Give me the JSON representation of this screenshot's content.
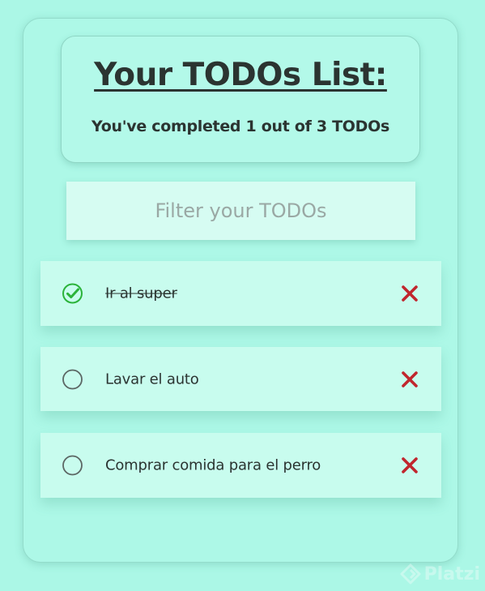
{
  "header": {
    "title": "Your TODOs List:",
    "progress": "You've completed 1 out of 3 TODOs"
  },
  "search": {
    "placeholder": "Filter your TODOs"
  },
  "todos": [
    {
      "text": "Ir al super",
      "completed": true
    },
    {
      "text": "Lavar el auto",
      "completed": false
    },
    {
      "text": "Comprar comida para el perro",
      "completed": false
    }
  ],
  "icons": {
    "check": "check-circle-icon",
    "uncheck": "circle-icon",
    "delete": "x-icon",
    "brand": "platzi-logo-icon"
  },
  "colors": {
    "background": "#abf7e6",
    "check_green": "#2bb33a",
    "delete_red": "#c0262d"
  },
  "watermark": {
    "text": "Platzi"
  }
}
